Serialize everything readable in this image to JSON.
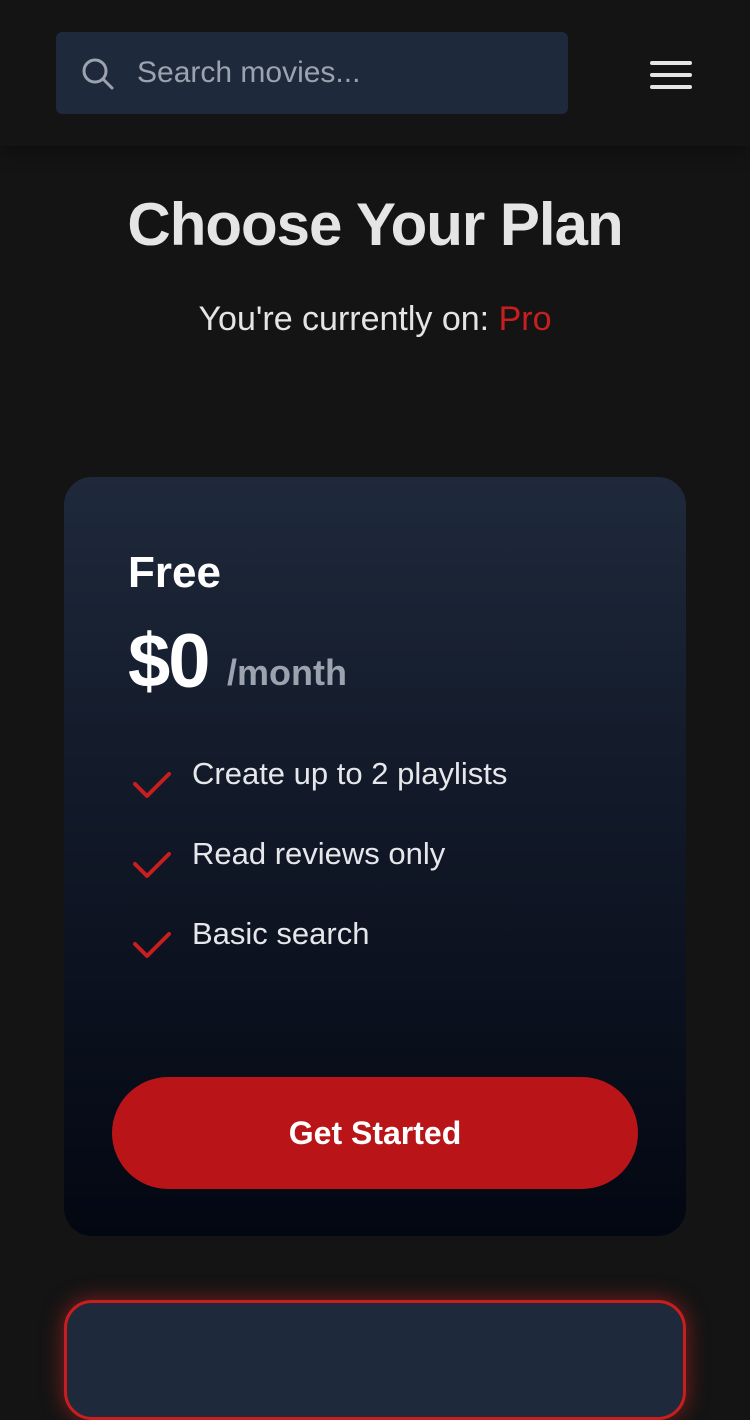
{
  "header": {
    "search": {
      "placeholder": "Search movies...",
      "value": "",
      "icon": "search-icon"
    },
    "menu_icon": "hamburger-menu-icon"
  },
  "page": {
    "title": "Choose Your Plan",
    "current_prefix": "You're currently on: ",
    "current_plan": "Pro"
  },
  "plans": [
    {
      "name": "Free",
      "price": "$0",
      "period": "/month",
      "features": [
        {
          "label": "Create up to 2 playlists",
          "icon": "check-icon"
        },
        {
          "label": "Read reviews only",
          "icon": "check-icon"
        },
        {
          "label": "Basic search",
          "icon": "check-icon"
        }
      ],
      "cta_label": "Get Started"
    }
  ],
  "colors": {
    "background": "#141414",
    "surface": "#1e293b",
    "accent": "#b91518",
    "accent_text": "#c81e1e",
    "muted_text": "#9ca3af"
  }
}
